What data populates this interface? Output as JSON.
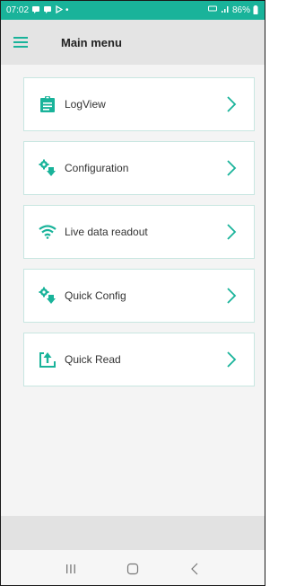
{
  "status_bar": {
    "time": "07:02",
    "notification_icons": [
      "message-icon",
      "message-icon",
      "play-icon"
    ],
    "dot": "•",
    "battery": "86%"
  },
  "app_bar": {
    "title": "Main menu",
    "menu_icon": "hamburger-icon"
  },
  "menu": {
    "items": [
      {
        "label": "LogView",
        "icon": "clipboard-icon"
      },
      {
        "label": "Configuration",
        "icon": "gears-icon"
      },
      {
        "label": "Live data readout",
        "icon": "wifi-icon"
      },
      {
        "label": "Quick Config",
        "icon": "gears-icon"
      },
      {
        "label": "Quick Read",
        "icon": "upload-icon"
      }
    ]
  },
  "colors": {
    "status_bar": "#19b39a",
    "accent": "#19b39a",
    "app_bar": "#e4e4e4",
    "background": "#f4f4f4",
    "card_border": "#c8e6e1"
  },
  "nav": {
    "buttons": [
      "recent-apps-icon",
      "home-icon",
      "back-icon"
    ]
  }
}
